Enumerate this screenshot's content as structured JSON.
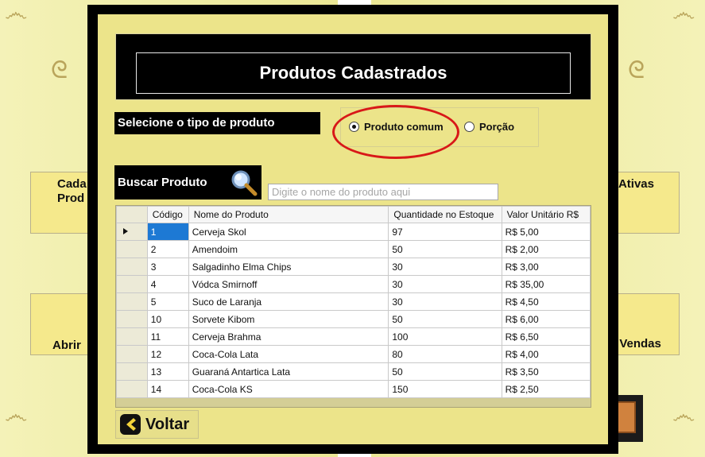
{
  "background": {
    "tile_top_left": "Cada\nProd",
    "tile_top_right": "s Ativas",
    "tile_bottom_left": "Abrir",
    "tile_bottom_right": "o Vendas"
  },
  "modal": {
    "title": "Produtos Cadastrados",
    "select_type_label": "Selecione o tipo de produto",
    "radio_options": [
      {
        "label": "Produto comum",
        "selected": true
      },
      {
        "label": "Porção",
        "selected": false
      }
    ],
    "search_label": "Buscar Produto",
    "search_placeholder": "Digite o nome do produto aqui",
    "back_button": "Voltar"
  },
  "table": {
    "columns": [
      "Código",
      "Nome do Produto",
      "Quantidade no Estoque",
      "Valor Unitário R$"
    ],
    "rows": [
      [
        "1",
        "Cerveja Skol",
        "97",
        "R$ 5,00"
      ],
      [
        "2",
        "Amendoim",
        "50",
        "R$ 2,00"
      ],
      [
        "3",
        "Salgadinho Elma Chips",
        "30",
        "R$ 3,00"
      ],
      [
        "4",
        "Vódca Smirnoff",
        "30",
        "R$ 35,00"
      ],
      [
        "5",
        "Suco de Laranja",
        "30",
        "R$ 4,50"
      ],
      [
        "10",
        "Sorvete Kibom",
        "50",
        "R$ 6,00"
      ],
      [
        "11",
        "Cerveja Brahma",
        "100",
        "R$ 6,50"
      ],
      [
        "12",
        "Coca-Cola Lata",
        "80",
        "R$ 4,00"
      ],
      [
        "13",
        "Guaraná Antartica Lata",
        "50",
        "R$ 3,50"
      ],
      [
        "14",
        "Coca-Cola KS",
        "150",
        "R$ 2,50"
      ]
    ],
    "selected_row_index": 0
  },
  "colors": {
    "highlight": "#1d79d4",
    "annotation": "#d81818"
  }
}
